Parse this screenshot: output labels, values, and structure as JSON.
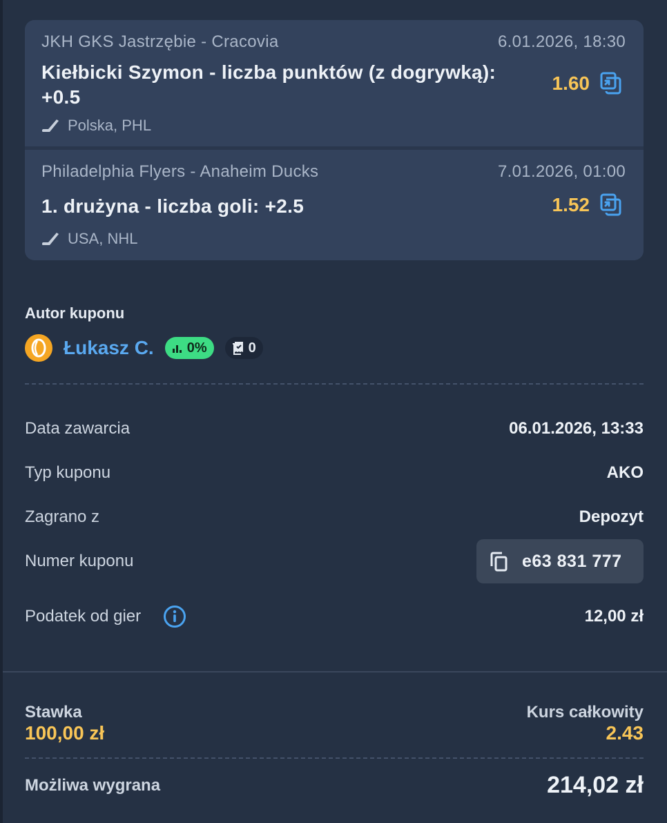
{
  "events": [
    {
      "teams": "JKH GKS Jastrzębie - Cracovia",
      "date": "6.01.2026, 18:30",
      "market_line1": "Kiełbicki Szymon - liczba punktów (z dogrywką):",
      "market_line2": "+0.5",
      "odds": "1.60",
      "league": "Polska, PHL",
      "icon": "hockey-stick-icon"
    },
    {
      "teams": "Philadelphia Flyers - Anaheim Ducks",
      "date": "7.01.2026, 01:00",
      "market_line1": "1. drużyna - liczba goli: +2.5",
      "odds": "1.52",
      "league": "USA, NHL",
      "icon": "hockey-stick-icon"
    }
  ],
  "author": {
    "heading": "Autor kuponu",
    "name": "Łukasz C.",
    "win_rate": "0%",
    "coupons": "0"
  },
  "details": [
    {
      "label": "Data zawarcia",
      "value": "06.01.2026, 13:33"
    },
    {
      "label": "Typ kuponu",
      "value": "AKO"
    },
    {
      "label": "Zagrano z",
      "value": "Depozyt"
    },
    {
      "label": "Numer kuponu",
      "value": "e63 831 777"
    },
    {
      "label": "Podatek od gier",
      "value": "12,00 zł"
    }
  ],
  "summary": {
    "stake_label": "Stawka",
    "stake_value": "100,00 zł",
    "total_odds_label": "Kurs całkowity",
    "total_odds_value": "2.43",
    "win_label": "Możliwa wygrana",
    "win_value": "214,02 zł"
  },
  "colors": {
    "background": "#253144",
    "card": "#33425c",
    "accent_odds": "#f8c557",
    "accent_link": "#5aa9f0",
    "badge_green": "#3ddc84"
  }
}
